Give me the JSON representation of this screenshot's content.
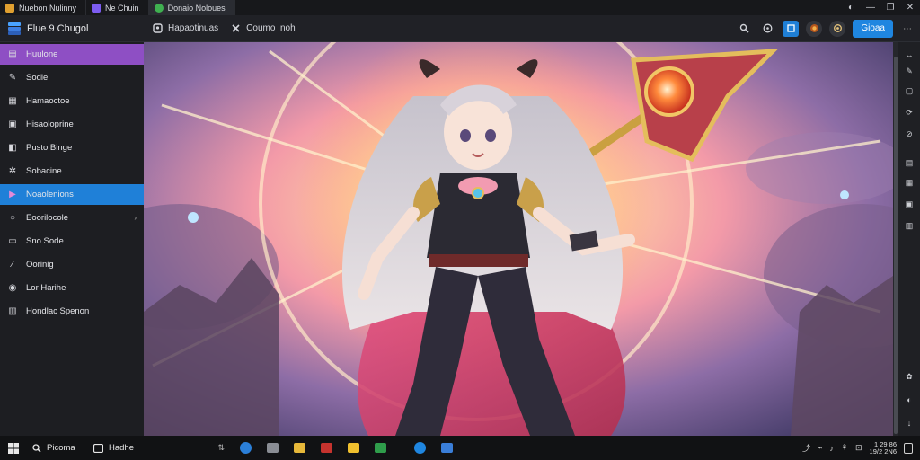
{
  "tabs": [
    {
      "label": "Nuebon Nulinny",
      "color": "#e0a030",
      "active": false
    },
    {
      "label": "Ne Chuin",
      "color": "#7c5cf0",
      "active": false
    },
    {
      "label": "Donaio Noloues",
      "color": "#3fb050",
      "active": true
    }
  ],
  "window_controls": [
    "◐",
    "—",
    "❐",
    "✕"
  ],
  "app": {
    "title": "Flue 9 Chugol"
  },
  "toolbar": {
    "crumbs": [
      {
        "icon": "user-icon",
        "label": "Hapaotinuas"
      },
      {
        "icon": "tools-icon",
        "label": "Coumo Inoh"
      }
    ],
    "primary_button": "Gioaa",
    "icon_buttons": [
      "search-icon",
      "help-icon",
      "profile-icon",
      "fire-icon",
      "settings-icon"
    ]
  },
  "sidebar": {
    "items": [
      {
        "label": "Huulone",
        "icon": "layers-icon",
        "glyph": "▤",
        "state": "purple"
      },
      {
        "label": "Sodie",
        "icon": "pin-icon",
        "glyph": "✎",
        "state": ""
      },
      {
        "label": "Hamaoctoe",
        "icon": "list-icon",
        "glyph": "▦",
        "state": ""
      },
      {
        "label": "Hisaoloprine",
        "icon": "doc-icon",
        "glyph": "▣",
        "state": ""
      },
      {
        "label": "Pusto Binge",
        "icon": "image-icon",
        "glyph": "◧",
        "state": ""
      },
      {
        "label": "Sobacine",
        "icon": "settings-icon",
        "glyph": "✲",
        "state": ""
      },
      {
        "label": "Noaolenions",
        "icon": "media-icon",
        "glyph": "▶",
        "state": "blue"
      },
      {
        "label": "Eoorilocole",
        "icon": "circle-icon",
        "glyph": "○",
        "state": "",
        "caret": true
      },
      {
        "label": "Sno Sode",
        "icon": "box-icon",
        "glyph": "▭",
        "state": ""
      },
      {
        "label": "Oorinig",
        "icon": "brush-icon",
        "glyph": "∕",
        "state": ""
      },
      {
        "label": "Lor Harihe",
        "icon": "target-icon",
        "glyph": "◉",
        "state": ""
      },
      {
        "label": "Hondlac Spenon",
        "icon": "grid-icon",
        "glyph": "▥",
        "state": ""
      }
    ]
  },
  "rail": [
    "↔",
    "✎",
    "▢",
    "⟳",
    "⊘",
    "▤",
    "▦",
    "▣",
    "▥",
    "✿",
    "◐",
    "↓"
  ],
  "taskbar": {
    "search_label": "Picoma",
    "chip_label": "Hadhe",
    "pins": [
      {
        "name": "browser-icon",
        "color": "#2b7fd8"
      },
      {
        "name": "files-icon",
        "color": "#8a8d94"
      },
      {
        "name": "folder-icon",
        "color": "#e7b83a"
      },
      {
        "name": "media-icon",
        "color": "#c6332e"
      },
      {
        "name": "explorer-icon",
        "color": "#f0c02e"
      },
      {
        "name": "sheet-icon",
        "color": "#2f9d4b"
      },
      {
        "name": "edge-icon",
        "color": "#1f86e0"
      },
      {
        "name": "store-icon",
        "color": "#3a7ed8"
      }
    ],
    "tray": [
      "⤴",
      "⌁",
      "♪",
      "⚘",
      "⊡"
    ],
    "clock_time": "1 29 86",
    "clock_date": "19/2 2N6"
  }
}
